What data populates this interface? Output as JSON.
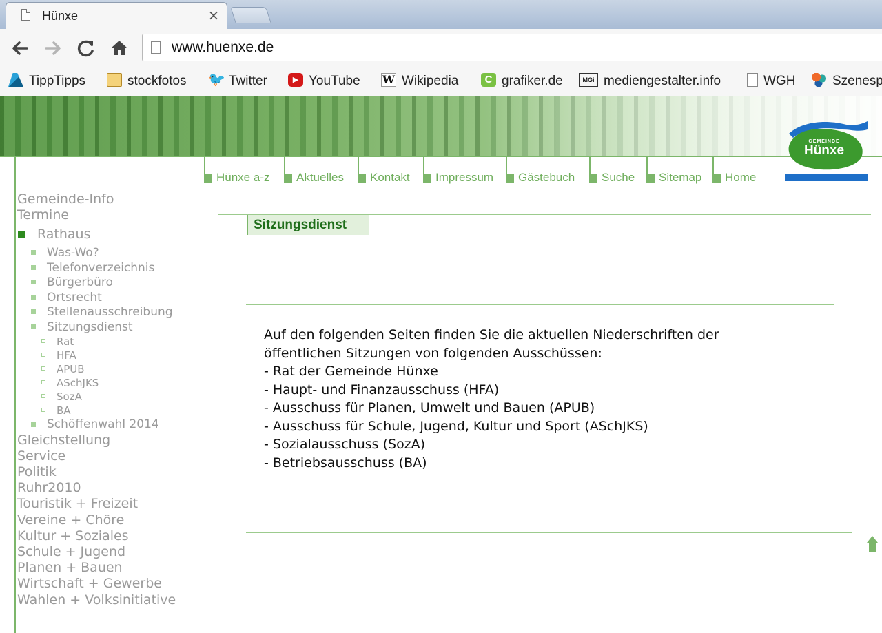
{
  "browser": {
    "tab_title": "Hünxe",
    "tab_close": "×",
    "url": "www.huenxe.de",
    "bookmarks": [
      {
        "label": "TippTipps",
        "icon": "tipptipps-icon"
      },
      {
        "label": "stockfotos",
        "icon": "folder-icon"
      },
      {
        "label": "Twitter",
        "icon": "twitter-icon"
      },
      {
        "label": "YouTube",
        "icon": "youtube-icon"
      },
      {
        "label": "Wikipedia",
        "icon": "wikipedia-icon"
      },
      {
        "label": "grafiker.de",
        "icon": "grafiker-icon"
      },
      {
        "label": "mediengestalter.info",
        "icon": "mgi-icon"
      },
      {
        "label": "WGH",
        "icon": "page-icon"
      },
      {
        "label": "Szenesp",
        "icon": "szene-icon"
      }
    ],
    "wiki_glyph": "W",
    "mgi_glyph": "MGi",
    "grafiker_glyph": "C"
  },
  "site": {
    "logo": {
      "small": "GEMEINDE",
      "big": "Hünxe"
    },
    "topnav": [
      "Hünxe a-z",
      "Aktuelles",
      "Kontakt",
      "Impressum",
      "Gästebuch",
      "Suche",
      "Sitemap",
      "Home"
    ],
    "leftnav": {
      "gemeinde_info": "Gemeinde-Info",
      "termine": "Termine",
      "rathaus": "Rathaus",
      "rathaus_sub": [
        "Was-Wo?",
        "Telefonverzeichnis",
        "Bürgerbüro",
        "Ortsrecht",
        "Stellenausschreibung",
        "Sitzungsdienst"
      ],
      "sitzungsdienst_sub": [
        "Rat",
        "HFA",
        "APUB",
        "ASchJKS",
        "SozA",
        "BA"
      ],
      "schoeffenwahl": "Schöffenwahl 2014",
      "rest": [
        "Gleichstellung",
        "Service",
        "Politik",
        "Ruhr2010",
        "Touristik + Freizeit",
        "Vereine + Chöre",
        "Kultur + Soziales",
        "Schule + Jugend",
        "Planen + Bauen",
        "Wirtschaft + Gewerbe",
        "Wahlen + Volksinitiative"
      ]
    },
    "content": {
      "heading": "Sitzungsdienst",
      "lines": [
        "Auf den folgenden Seiten finden Sie die aktuellen Niederschriften der",
        "öffentlichen Sitzungen von folgenden Ausschüssen:",
        "- Rat der Gemeinde Hünxe",
        "- Haupt- und Finanzausschuss (HFA)",
        "- Ausschuss für Planen, Umwelt und Bauen (APUB)",
        "- Ausschuss für Schule, Jugend, Kultur und Sport (ASchJKS)",
        "- Sozialausschuss (SozA)",
        "- Betriebsausschuss (BA)"
      ]
    }
  }
}
